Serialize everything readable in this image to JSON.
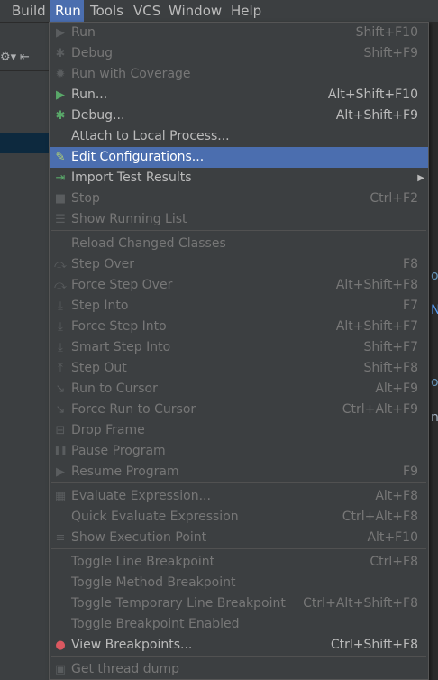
{
  "menubar": {
    "items": [
      "Build",
      "Run",
      "Tools",
      "VCS",
      "Window",
      "Help"
    ]
  },
  "toolbar": {
    "icons": [
      "gear-icon",
      "collapse-icon"
    ]
  },
  "right_strip": {
    "chars": [
      "ou",
      "N",
      "o",
      "n"
    ]
  },
  "run_menu": {
    "items": [
      {
        "label": "Run",
        "shortcut": "Shift+F10",
        "icon": "run-icon",
        "enabled": false
      },
      {
        "label": "Debug",
        "shortcut": "Shift+F9",
        "icon": "debug-icon",
        "enabled": false
      },
      {
        "label": "Run with Coverage",
        "shortcut": "",
        "icon": "coverage-icon",
        "enabled": false
      },
      {
        "label": "Run...",
        "shortcut": "Alt+Shift+F10",
        "icon": "run-icon",
        "enabled": true
      },
      {
        "label": "Debug...",
        "shortcut": "Alt+Shift+F9",
        "icon": "debug-icon",
        "enabled": true
      },
      {
        "label": "Attach to Local Process...",
        "shortcut": "",
        "icon": "",
        "enabled": true
      },
      {
        "label": "Edit Configurations...",
        "shortcut": "",
        "icon": "edit-config-icon",
        "enabled": true,
        "selected": true
      },
      {
        "label": "Import Test Results",
        "shortcut": "",
        "icon": "import-icon",
        "enabled": true,
        "submenu": true
      },
      {
        "label": "Stop",
        "shortcut": "Ctrl+F2",
        "icon": "stop-icon",
        "enabled": false
      },
      {
        "label": "Show Running List",
        "shortcut": "",
        "icon": "list-icon",
        "enabled": false
      },
      {
        "label": "Reload Changed Classes",
        "shortcut": "",
        "icon": "",
        "enabled": false
      },
      {
        "label": "Step Over",
        "shortcut": "F8",
        "icon": "step-over-icon",
        "enabled": false
      },
      {
        "label": "Force Step Over",
        "shortcut": "Alt+Shift+F8",
        "icon": "force-step-over-icon",
        "enabled": false
      },
      {
        "label": "Step Into",
        "shortcut": "F7",
        "icon": "step-into-icon",
        "enabled": false
      },
      {
        "label": "Force Step Into",
        "shortcut": "Alt+Shift+F7",
        "icon": "force-step-into-icon",
        "enabled": false
      },
      {
        "label": "Smart Step Into",
        "shortcut": "Shift+F7",
        "icon": "smart-step-into-icon",
        "enabled": false
      },
      {
        "label": "Step Out",
        "shortcut": "Shift+F8",
        "icon": "step-out-icon",
        "enabled": false
      },
      {
        "label": "Run to Cursor",
        "shortcut": "Alt+F9",
        "icon": "run-to-cursor-icon",
        "enabled": false
      },
      {
        "label": "Force Run to Cursor",
        "shortcut": "Ctrl+Alt+F9",
        "icon": "force-run-to-cursor-icon",
        "enabled": false
      },
      {
        "label": "Drop Frame",
        "shortcut": "",
        "icon": "drop-frame-icon",
        "enabled": false
      },
      {
        "label": "Pause Program",
        "shortcut": "",
        "icon": "pause-icon",
        "enabled": false
      },
      {
        "label": "Resume Program",
        "shortcut": "F9",
        "icon": "resume-icon",
        "enabled": false
      },
      {
        "label": "Evaluate Expression...",
        "shortcut": "Alt+F8",
        "icon": "evaluate-icon",
        "enabled": false
      },
      {
        "label": "Quick Evaluate Expression",
        "shortcut": "Ctrl+Alt+F8",
        "icon": "",
        "enabled": false
      },
      {
        "label": "Show Execution Point",
        "shortcut": "Alt+F10",
        "icon": "execution-point-icon",
        "enabled": false
      },
      {
        "label": "Toggle Line Breakpoint",
        "shortcut": "Ctrl+F8",
        "icon": "",
        "enabled": false
      },
      {
        "label": "Toggle Method Breakpoint",
        "shortcut": "",
        "icon": "",
        "enabled": false
      },
      {
        "label": "Toggle Temporary Line Breakpoint",
        "shortcut": "Ctrl+Alt+Shift+F8",
        "icon": "",
        "enabled": false
      },
      {
        "label": "Toggle Breakpoint Enabled",
        "shortcut": "",
        "icon": "",
        "enabled": false
      },
      {
        "label": "View Breakpoints...",
        "shortcut": "Ctrl+Shift+F8",
        "icon": "breakpoints-icon",
        "enabled": true
      },
      {
        "label": "Get thread dump",
        "shortcut": "",
        "icon": "thread-dump-icon",
        "enabled": false
      }
    ]
  },
  "colors": {
    "menu_bg": "#3c3f41",
    "selection": "#4b6eaf",
    "disabled_text": "#777777",
    "enabled_text": "#bbbbbb",
    "run_green": "#59a869",
    "breakpoint_red": "#db5860"
  }
}
